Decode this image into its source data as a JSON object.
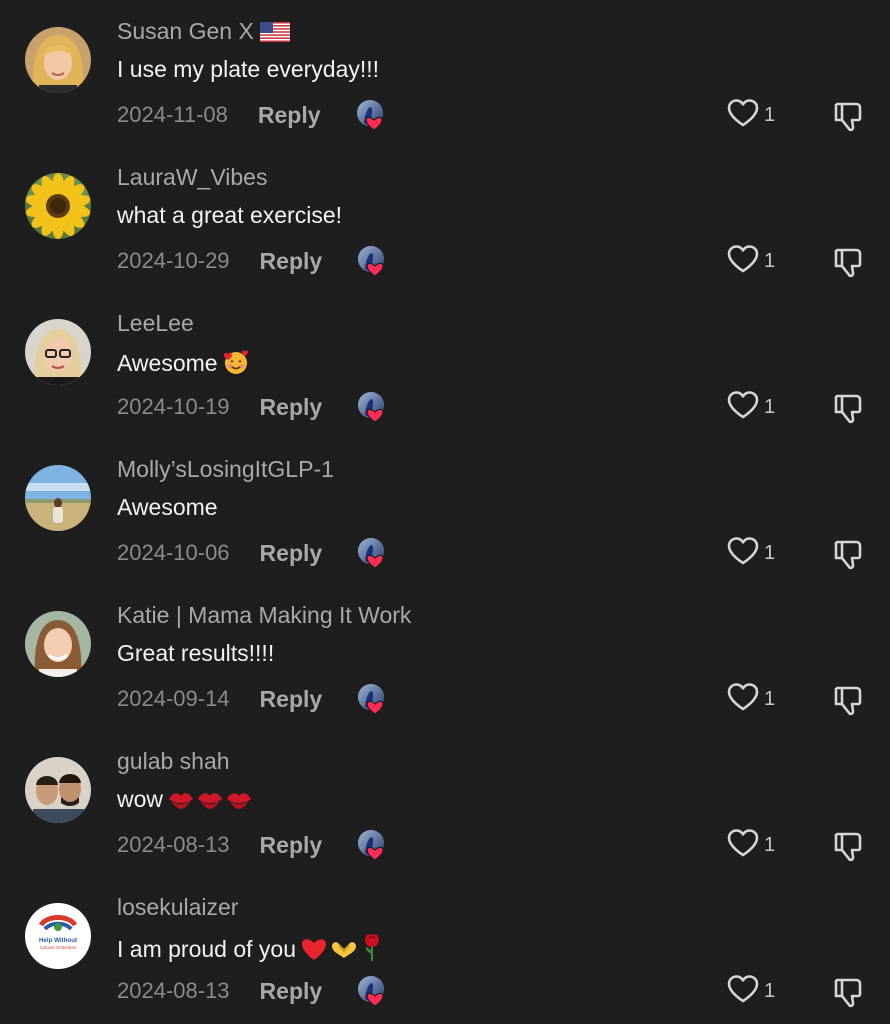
{
  "comments": [
    {
      "username": "Susan Gen X",
      "flag": "us-flag-icon",
      "text": "I use my plate everyday!!!",
      "emoji": [],
      "date": "2024-11-08",
      "reply": "Reply",
      "likes": "1",
      "avatar": "blonde-woman"
    },
    {
      "username": "LauraW_Vibes",
      "text": "what a great exercise!",
      "emoji": [],
      "date": "2024-10-29",
      "reply": "Reply",
      "likes": "1",
      "avatar": "sunflower"
    },
    {
      "username": "LeeLee",
      "text": "Awesome",
      "emoji": [
        "smiling-face-with-hearts-icon"
      ],
      "date": "2024-10-19",
      "reply": "Reply",
      "likes": "1",
      "avatar": "woman-glasses"
    },
    {
      "username": "Molly’sLosingItGLP-1",
      "text": "Awesome",
      "emoji": [],
      "date": "2024-10-06",
      "reply": "Reply",
      "likes": "1",
      "avatar": "beach-field"
    },
    {
      "username": "Katie | Mama Making It Work",
      "text": "Great results!!!!",
      "emoji": [],
      "date": "2024-09-14",
      "reply": "Reply",
      "likes": "1",
      "avatar": "brunette-woman"
    },
    {
      "username": "gulab shah",
      "text": "wow",
      "emoji": [
        "kiss-mark-icon",
        "kiss-mark-icon",
        "kiss-mark-icon"
      ],
      "date": "2024-08-13",
      "reply": "Reply",
      "likes": "1",
      "avatar": "two-men"
    },
    {
      "username": "losekulaizer",
      "text": "I am proud of you",
      "emoji": [
        "red-heart-icon",
        "heart-hands-icon",
        "rose-icon"
      ],
      "date": "2024-08-13",
      "reply": "Reply",
      "likes": "1",
      "avatar": "charity-logo",
      "avatar_text": [
        "Help Without",
        "Colours Or Borders"
      ]
    }
  ]
}
